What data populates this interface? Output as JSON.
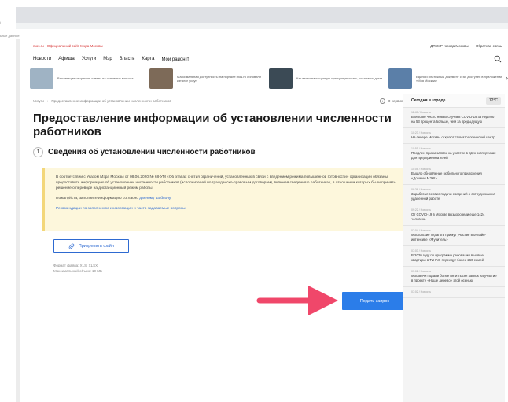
{
  "browser": {
    "url_hint": "i",
    "saved_label": "ьные данные"
  },
  "header": {
    "brand_short": "mos.ru",
    "brand_full": "Официальный сайт Мэра Москвы",
    "top_links": [
      "ДПиМР города Москвы",
      "Обратная связь"
    ]
  },
  "nav": {
    "items": [
      "Новости",
      "Афиша",
      "Услуги",
      "Мэр",
      "Власть",
      "Карта",
      "Мой район ▯"
    ]
  },
  "news_strip": [
    {
      "text": "Вакцинация от гриппа: ответы на основные вопросы",
      "color": "#9fb3c4"
    },
    {
      "text": "Максимальная доступность: на портале mos.ru обновили каталог услуг",
      "color": "#7d6a58"
    },
    {
      "text": "Как вести насыщенную культурную жизнь, оставаясь дома",
      "color": "#3b4a55"
    },
    {
      "text": "Единый платежный документ стал доступен в приложении «Моя Москва»",
      "color": "#5b7fa8"
    }
  ],
  "breadcrumb": {
    "root": "Услуги",
    "current": "Предоставление информации об установлении численности работников"
  },
  "service_link": "О сервисе",
  "page_title": "Предоставление информации об установлении численности работников",
  "section": {
    "step": "1",
    "title": "Сведения об установлении численности работников"
  },
  "notice": {
    "p1": "В соответствии с Указом Мэра Москвы от 08.06.2020 № 68-УМ «Об этапах снятия ограничений, установленных в связи с введением режима повышенной готовности» организации обязаны предоставить информацию об установлении численности работников (исполнителей по гражданско-правовым договорам), включая сведения о работниках, в отношении которых были приняты решение о переводе на дистанционный режим работы.",
    "p2_prefix": "Пожалуйста, заполните информацию согласно ",
    "p2_link": "данному шаблону",
    "p3": "Рекомендации по заполнению информации и часто задаваемые вопросы"
  },
  "attach": {
    "label": "Прикрепить файл",
    "formats": "Формат файла: XLS, XLSX",
    "max_size": "Максимальный объем: 10 МБ"
  },
  "submit_label": "Подать запрос",
  "colors": {
    "accent": "#2b7de9",
    "arrow": "#f0476a",
    "notice_bg": "#fdf7dc"
  },
  "sidebar": {
    "title": "Сегодня в городе",
    "temperature": "12°C",
    "items": [
      {
        "meta": "11:45 / Новость",
        "text": "В Москве число новых случаев COVID-19 за неделю на 53 процента больше, чем за предыдущую"
      },
      {
        "meta": "10:23 / Новость",
        "text": "На севере Москвы откроют стоматологический центр"
      },
      {
        "meta": "10:51 / Новость",
        "text": "Продлен прием заявок на участие в двух экспертизах для предпринимателей"
      },
      {
        "meta": "10:05 / Новость",
        "text": "Вышло обновление мобильного приложения «Домены МЭШ»"
      },
      {
        "meta": "09:36 / Новость",
        "text": "Заработал сервис подачи сведений о сотрудниках на удаленной работе"
      },
      {
        "meta": "09:22 / Новость",
        "text": "От COVID-19 в Москве выздоровели еще 1424 человека"
      },
      {
        "meta": "07:04 / Новость",
        "text": "Московские педагоги примут участие в онлайн-интенсиве «Я учитель»"
      },
      {
        "meta": "07:03 / Новость",
        "text": "В 2020 году по программе реновации в новые квартиры в ТиНАО переедут более 260 семей"
      },
      {
        "meta": "07:02 / Новость",
        "text": "Москвичи подали более пяти тысяч заявок на участие в проекте «Наше дерево» этой осенью"
      },
      {
        "meta": "07:02 / Новость",
        "text": ""
      }
    ]
  }
}
